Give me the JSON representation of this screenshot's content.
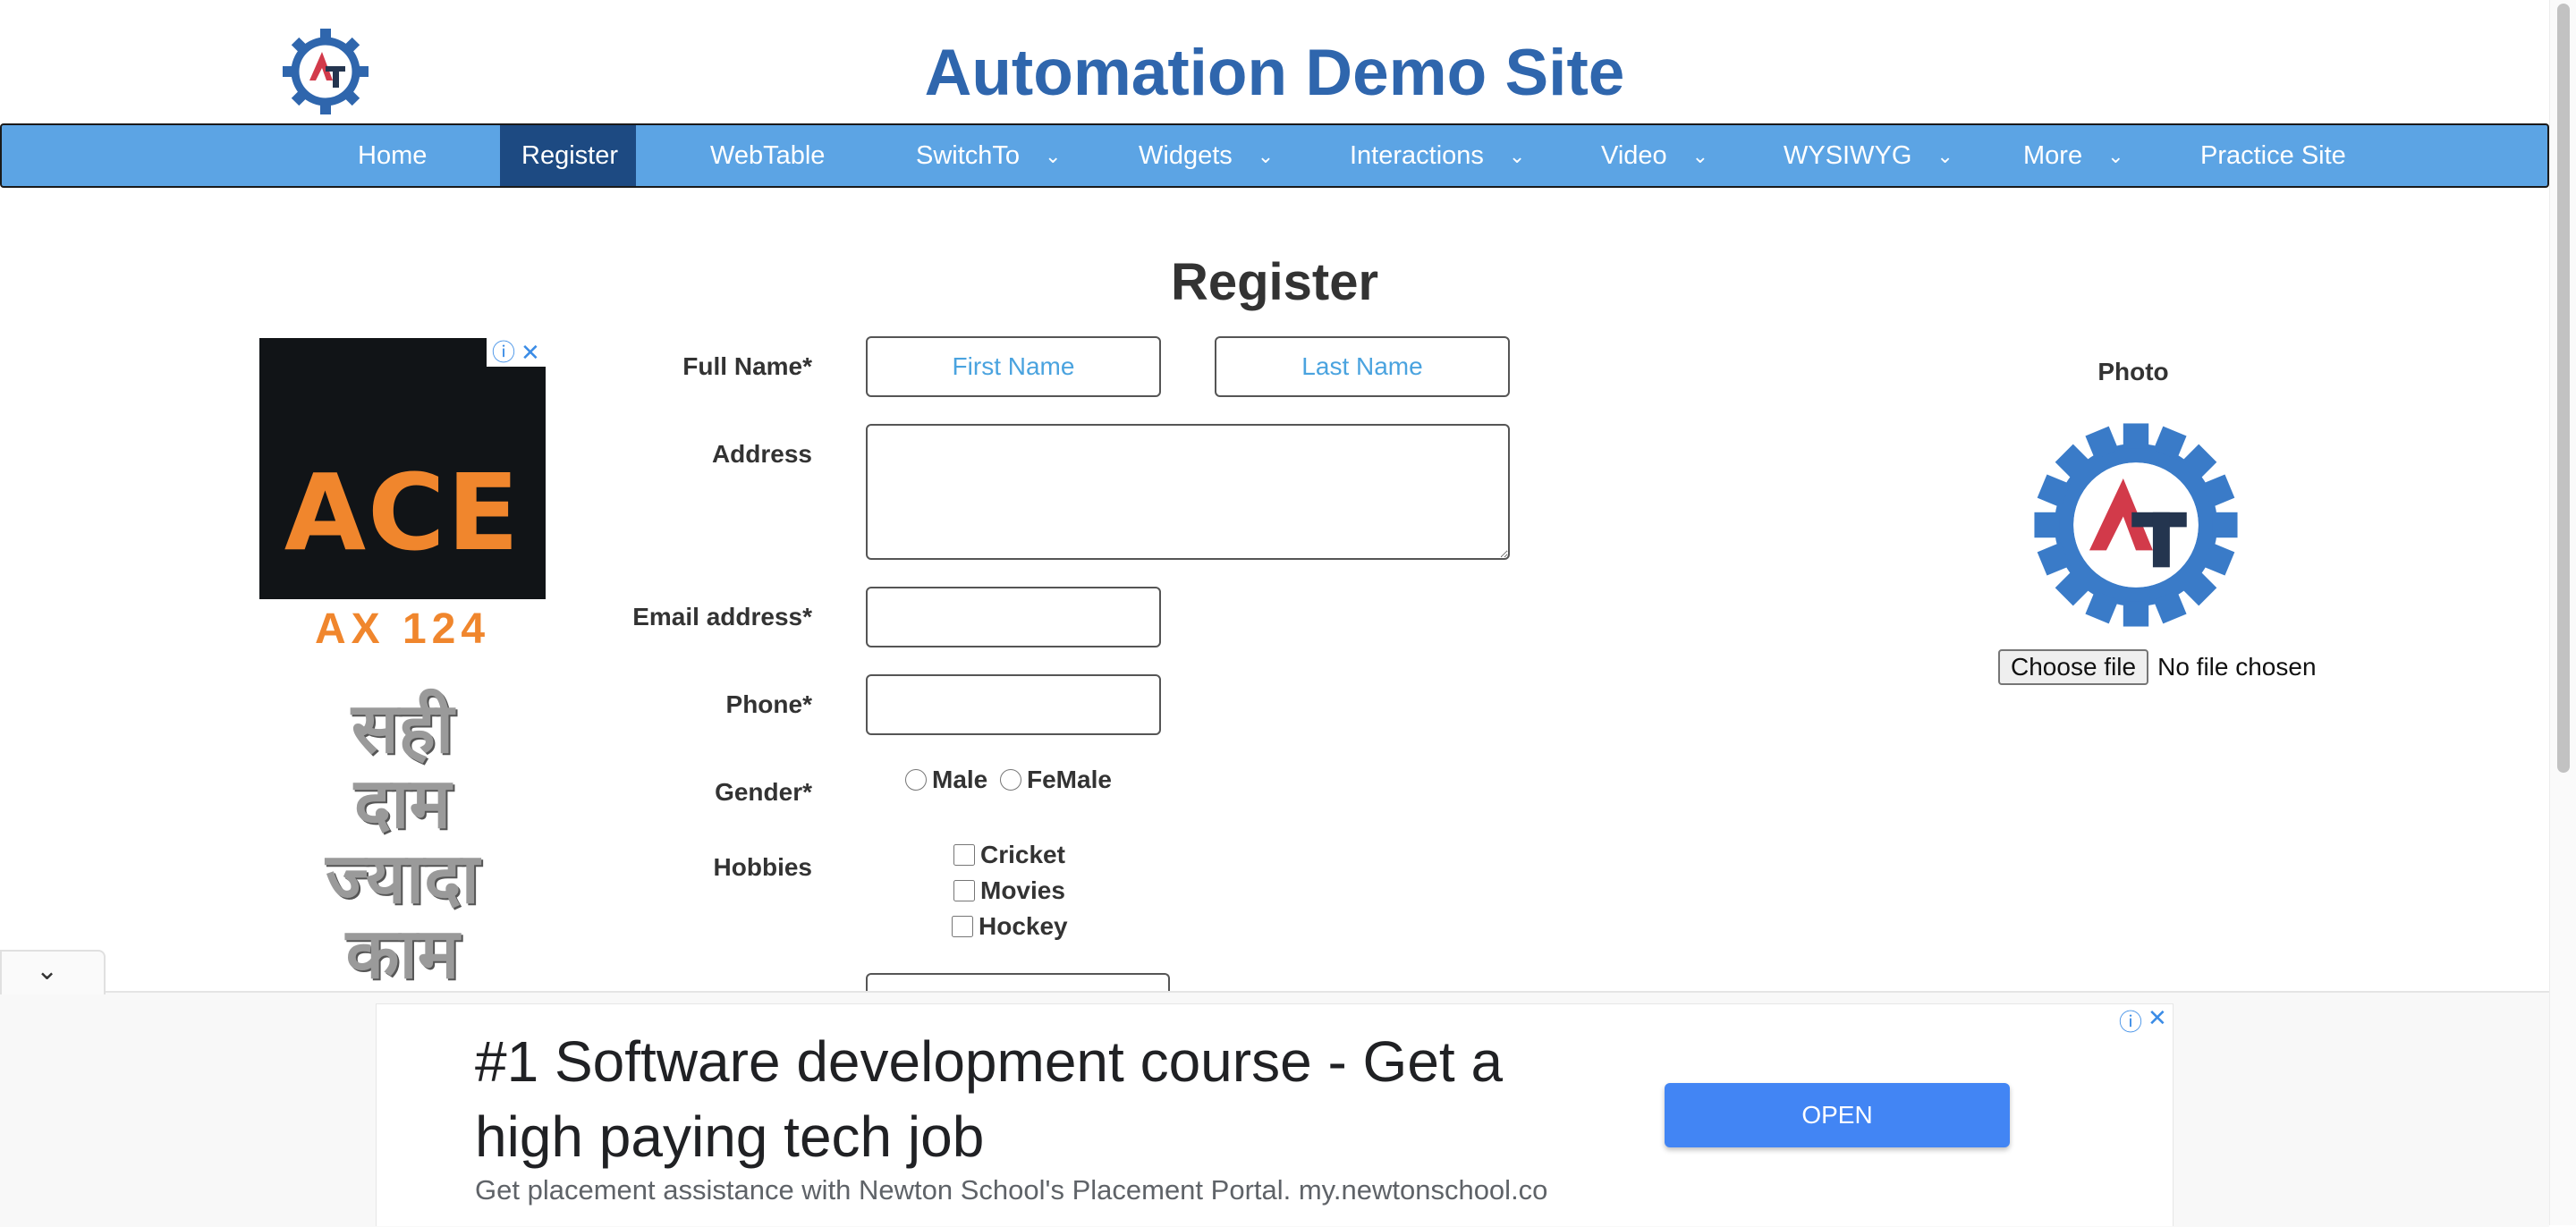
{
  "header": {
    "site_title": "Automation Demo Site",
    "logo_icon": "automation-gear-logo",
    "brand_blue": "#2f66ad"
  },
  "nav": {
    "items": [
      {
        "label": "Home",
        "has_dropdown": false
      },
      {
        "label": "Register",
        "has_dropdown": false,
        "active": true
      },
      {
        "label": "WebTable",
        "has_dropdown": false
      },
      {
        "label": "SwitchTo",
        "has_dropdown": true
      },
      {
        "label": "Widgets",
        "has_dropdown": true
      },
      {
        "label": "Interactions",
        "has_dropdown": true
      },
      {
        "label": "Video",
        "has_dropdown": true
      },
      {
        "label": "WYSIWYG",
        "has_dropdown": true
      },
      {
        "label": "More",
        "has_dropdown": true
      },
      {
        "label": "Practice Site",
        "has_dropdown": false
      }
    ],
    "bar_color": "#5ca4e4",
    "active_color": "#1d4a82"
  },
  "form": {
    "heading": "Register",
    "full_name_label": "Full Name*",
    "first_name_placeholder": "First Name",
    "last_name_placeholder": "Last Name",
    "address_label": "Address",
    "email_label": "Email address*",
    "phone_label": "Phone*",
    "gender_label": "Gender*",
    "gender_options": [
      "Male",
      "FeMale"
    ],
    "hobbies_label": "Hobbies",
    "hobbies": [
      "Cricket",
      "Movies",
      "Hockey"
    ]
  },
  "photo": {
    "label": "Photo",
    "choose_file": "Choose file",
    "file_status": "No file chosen"
  },
  "ads": {
    "left": {
      "brand": "ACE",
      "model": "AX 124",
      "hindi_lines": [
        "सही",
        "दाम",
        "ज्यादा",
        "काम"
      ]
    },
    "bottom": {
      "headline": "#1 Software development course - Get a high paying tech job",
      "subtext": "Get placement assistance with Newton School's Placement Portal. my.newtonschool.co",
      "open_button": "OPEN",
      "info_icon": "ⓘ",
      "close_icon": "✕"
    }
  },
  "collapse": {
    "icon": "chevron-down"
  }
}
